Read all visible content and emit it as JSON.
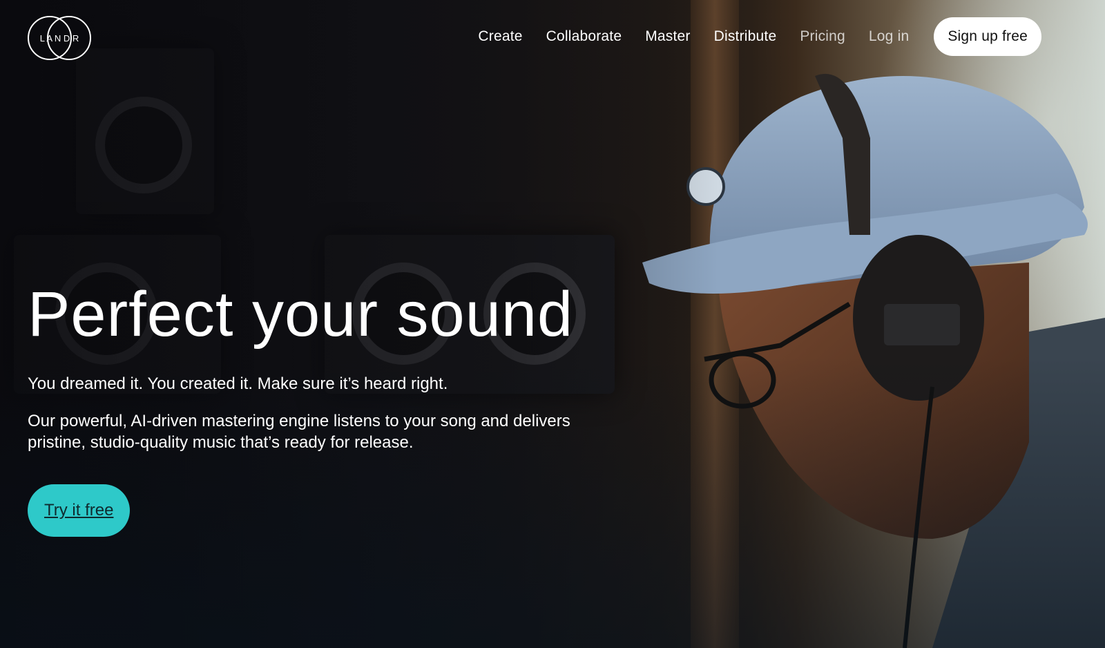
{
  "brand": {
    "logo_text": "L A N D R"
  },
  "nav": {
    "items": [
      {
        "label": "Create"
      },
      {
        "label": "Collaborate"
      },
      {
        "label": "Master"
      },
      {
        "label": "Distribute"
      },
      {
        "label": "Pricing"
      },
      {
        "label": "Log in"
      }
    ],
    "signup_label": "Sign up free"
  },
  "hero": {
    "headline": "Perfect your sound",
    "subheadline": "You dreamed it. You created it. Make sure it’s heard right.",
    "description": "Our powerful, AI-driven mastering engine listens to your song and delivers pristine, studio-quality music that’s ready for release.",
    "cta_label": "Try it free"
  },
  "colors": {
    "accent": "#2ec9c9",
    "signup_bg": "#ffffff"
  }
}
